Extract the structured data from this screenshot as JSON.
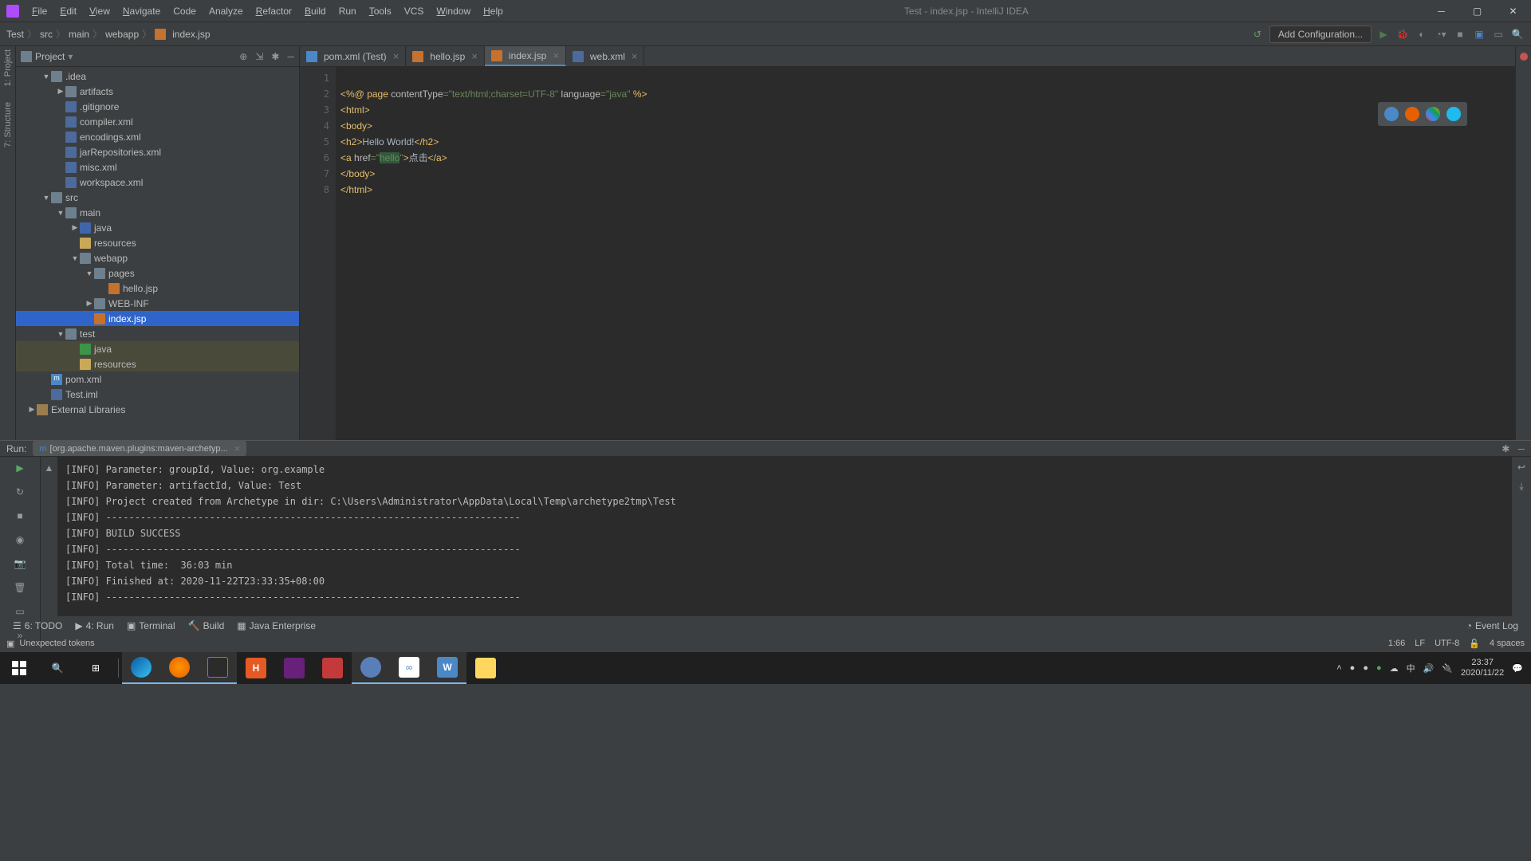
{
  "window": {
    "title": "Test - index.jsp - IntelliJ IDEA"
  },
  "menu": [
    "File",
    "Edit",
    "View",
    "Navigate",
    "Code",
    "Analyze",
    "Refactor",
    "Build",
    "Run",
    "Tools",
    "VCS",
    "Window",
    "Help"
  ],
  "breadcrumb": [
    "Test",
    "src",
    "main",
    "webapp",
    "index.jsp"
  ],
  "add_config": "Add Configuration...",
  "project_label": "Project",
  "left_strip": [
    "1: Project",
    "7: Structure"
  ],
  "tree": {
    "idea": ".idea",
    "artifacts": "artifacts",
    "gitignore": ".gitignore",
    "compiler": "compiler.xml",
    "encodings": "encodings.xml",
    "jarrepos": "jarRepositories.xml",
    "misc": "misc.xml",
    "workspace": "workspace.xml",
    "src": "src",
    "main": "main",
    "java": "java",
    "resources": "resources",
    "webapp": "webapp",
    "pages": "pages",
    "hello": "hello.jsp",
    "webinf": "WEB-INF",
    "index": "index.jsp",
    "test": "test",
    "tjava": "java",
    "tresources": "resources",
    "pom": "pom.xml",
    "testiml": "Test.iml",
    "extlib": "External Libraries"
  },
  "tabs": [
    {
      "name": "pom.xml (Test)",
      "icon": "m"
    },
    {
      "name": "hello.jsp",
      "icon": "j"
    },
    {
      "name": "index.jsp",
      "icon": "j",
      "active": true
    },
    {
      "name": "web.xml",
      "icon": "x"
    }
  ],
  "code": {
    "l1a": "<%@ ",
    "l1b": "page ",
    "l1c": "contentType",
    "l1d": "=",
    "l1e": "\"text/html;charset=UTF-8\" ",
    "l1f": "language",
    "l1g": "=",
    "l1h": "\"java\" ",
    "l1i": "%>",
    "l2": "<html>",
    "l3": "<body>",
    "l4a": "<h2>",
    "l4b": "Hello World!",
    "l4c": "</h2>",
    "l5a": "<a ",
    "l5b": "href",
    "l5c": "=",
    "l5d": "\"",
    "l5e": "hello",
    "l5f": "\"",
    "l5g": ">",
    "l5h": "点击",
    "l5i": "</a>",
    "l6": "</body>",
    "l7": "</html>"
  },
  "run": {
    "label": "Run:",
    "tab": "[org.apache.maven.plugins:maven-archetyp...",
    "lines": [
      "[INFO] Parameter: groupId, Value: org.example",
      "[INFO] Parameter: artifactId, Value: Test",
      "[INFO] Project created from Archetype in dir: C:\\Users\\Administrator\\AppData\\Local\\Temp\\archetype2tmp\\Test",
      "[INFO] ------------------------------------------------------------------------",
      "[INFO] BUILD SUCCESS",
      "[INFO] ------------------------------------------------------------------------",
      "[INFO] Total time:  36:03 min",
      "[INFO] Finished at: 2020-11-22T23:33:35+08:00",
      "[INFO] ------------------------------------------------------------------------"
    ]
  },
  "statusbar": {
    "todo": "6: TODO",
    "run": "4: Run",
    "terminal": "Terminal",
    "build": "Build",
    "javaee": "Java Enterprise",
    "eventlog": "Event Log"
  },
  "infobar": {
    "msg": "Unexpected tokens",
    "pos": "1:66",
    "lf": "LF",
    "enc": "UTF-8",
    "spaces": "4 spaces"
  },
  "taskbar": {
    "time": "23:37",
    "date": "2020/11/22"
  }
}
